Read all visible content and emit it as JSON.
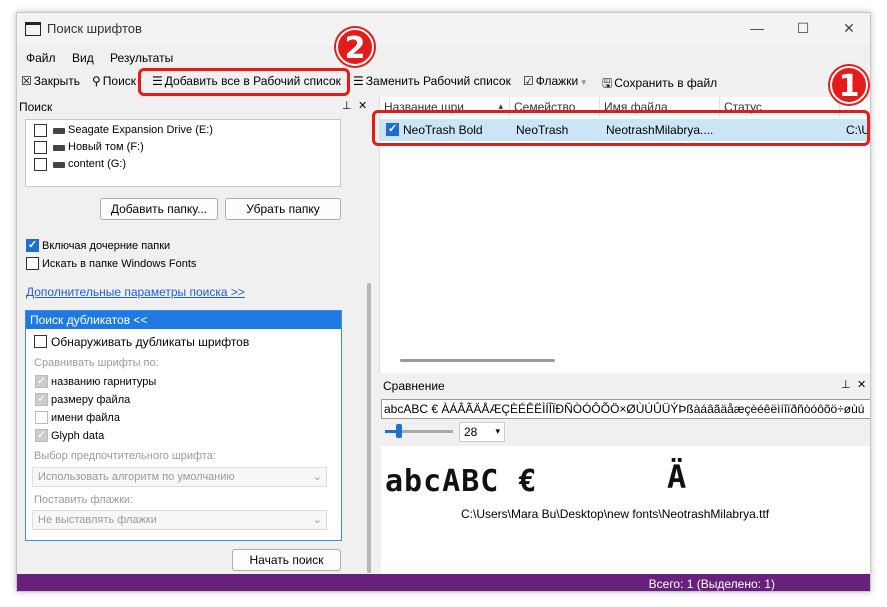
{
  "window": {
    "title": "Поиск шрифтов",
    "controls": {
      "minimize": "—",
      "maximize": "☐",
      "close": "✕"
    }
  },
  "menu": [
    "Файл",
    "Вид",
    "Результаты"
  ],
  "toolbar": {
    "close": "Закрыть",
    "search": "Поиск",
    "add_all": "Добавить все в Рабочий список",
    "replace": "Заменить Рабочий список",
    "flags": "Флажки",
    "save": "Сохранить в файл"
  },
  "search_pane": {
    "title": "Поиск",
    "drives": [
      {
        "label": "Seagate Expansion Drive (E:)",
        "checked": false
      },
      {
        "label": "Новый том (F:)",
        "checked": false
      },
      {
        "label": "content (G:)",
        "checked": false
      }
    ],
    "add_folder": "Добавить папку...",
    "remove_folder": "Убрать папку",
    "include_subfolders": "Включая дочерние папки",
    "windows_fonts": "Искать в папке Windows Fonts",
    "advanced_link": "Дополнительные параметры поиска >>",
    "duplicates": {
      "header": "Поиск дубликатов <<",
      "detect": "Обнаруживать дубликаты шрифтов",
      "compare_by": "Сравнивать шрифты по:",
      "options": [
        "названию гарнитуры",
        "размеру файла",
        "имени файла",
        "Glyph data"
      ],
      "preferred_label": "Выбор предпочтительного шрифта:",
      "preferred_value": "Использовать алгоритм по умолчанию",
      "flags_label": "Поставить флажки:",
      "flags_value": "Не выставлять флажки"
    },
    "start_button": "Начать поиск"
  },
  "results": {
    "columns": [
      "Название шри",
      "Семейство",
      "Имя файла",
      "Статус"
    ],
    "rows": [
      {
        "name": "NeoTrash Bold",
        "family": "NeoTrash",
        "file": "NeotrashMilabrya....",
        "status": "",
        "path": "C:\\U"
      }
    ]
  },
  "compare": {
    "title": "Сравнение",
    "sample": "abcABC € ÀÁÂÃÄÅÆÇÈÉÊËÌÍÎÏÐÑÒÓÔÕÖ×ØÙÚÛÜÝÞßàáâãäåæçèéêëìíîïðñòóôõö÷øùú",
    "size": "28",
    "preview_text": "abcABC €",
    "preview_char": "Ä",
    "file_path": "C:\\Users\\Mara Bu\\Desktop\\new fonts\\NeotrashMilabrya.ttf"
  },
  "status": "Всего: 1 (Выделено: 1)",
  "annotations": [
    "1",
    "2"
  ],
  "colors": {
    "accent": "#1f6fd1",
    "statusbar": "#68217a",
    "highlight": "#e41b1b"
  }
}
